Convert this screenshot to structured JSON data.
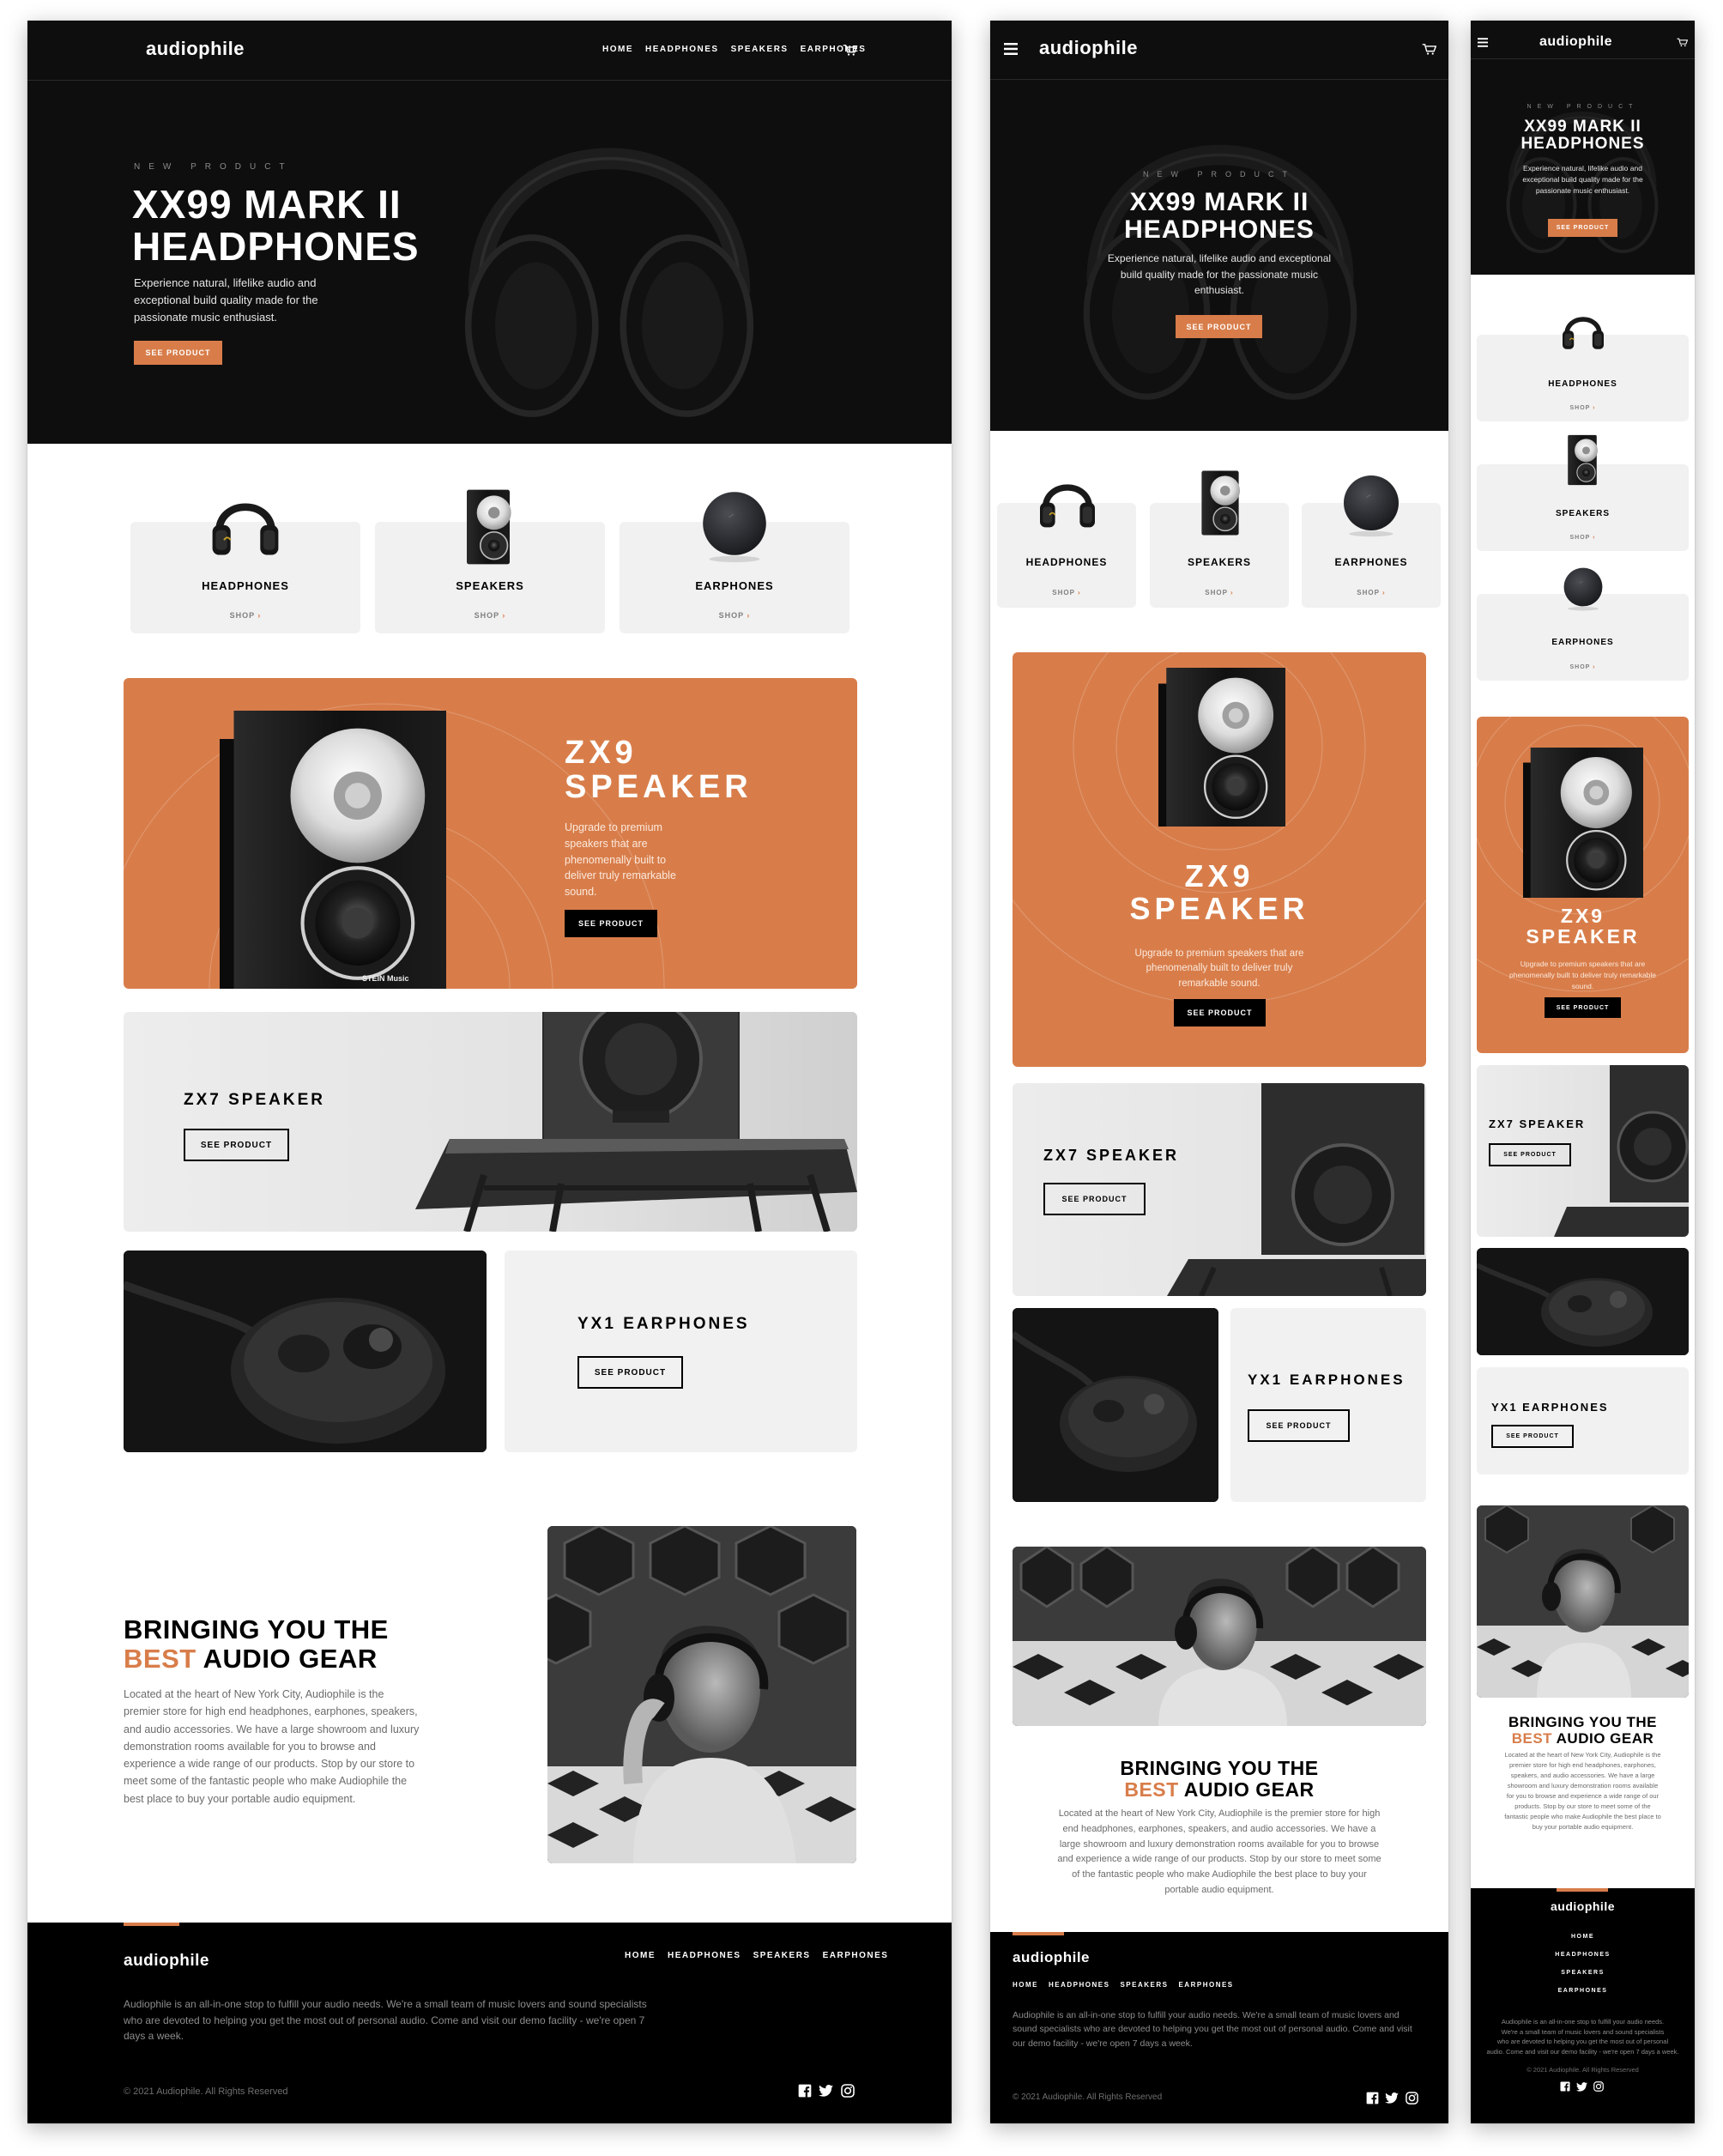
{
  "brand": {
    "name": "audiophile",
    "accent": "#d87d4a",
    "dark": "#000000",
    "card_bg": "#f1f1f1"
  },
  "nav": {
    "items": [
      "HOME",
      "HEADPHONES",
      "SPEAKERS",
      "EARPHONES"
    ],
    "cart_icon": "cart-icon",
    "menu_icon": "hamburger-icon"
  },
  "hero": {
    "overline": "NEW PRODUCT",
    "title_line1": "XX99 MARK II",
    "title_line2": "HEADPHONES",
    "description": "Experience natural, lifelike audio and exceptional build quality made for the passionate music enthusiast.",
    "desktop_desc_lines": [
      "Experience natural, lifelike audio and",
      "exceptional build quality made for the",
      "passionate music enthusiast."
    ],
    "tablet_desc_lines": [
      "Experience natural, lifelike audio and exceptional",
      "build quality made for the passionate music",
      "enthusiast."
    ],
    "mobile_desc_lines": [
      "Experience natural, lifelike audio and",
      "exceptional build quality made for the",
      "passionate music enthusiast."
    ],
    "cta": "SEE PRODUCT"
  },
  "categories": [
    {
      "name": "HEADPHONES",
      "shop": "SHOP"
    },
    {
      "name": "SPEAKERS",
      "shop": "SHOP"
    },
    {
      "name": "EARPHONES",
      "shop": "SHOP"
    }
  ],
  "zx9": {
    "title_line1": "ZX9",
    "title_line2": "SPEAKER",
    "description": "Upgrade to premium speakers that are phenomenally built to deliver truly remarkable sound.",
    "desktop_desc_lines": [
      "Upgrade to premium",
      "speakers that are",
      "phenomenally built to",
      "deliver truly remarkable",
      "sound."
    ],
    "tablet_desc_lines": [
      "Upgrade to premium speakers that are",
      "phenomenally built to deliver truly",
      "remarkable sound."
    ],
    "mobile_desc_lines": [
      "Upgrade to premium speakers that are",
      "phenomenally built to deliver truly remarkable",
      "sound."
    ],
    "brand_mark": "STEIN Music",
    "cta": "SEE PRODUCT"
  },
  "zx7": {
    "title": "ZX7 SPEAKER",
    "cta": "SEE PRODUCT"
  },
  "yx1": {
    "title": "YX1 EARPHONES",
    "cta": "SEE PRODUCT"
  },
  "about": {
    "title_line1": "BRINGING YOU THE",
    "title_accent": "BEST",
    "title_rest": "AUDIO GEAR",
    "description": "Located at the heart of New York City, Audiophile is the premier store for high end headphones, earphones, speakers, and audio accessories. We have a large showroom and luxury demonstration rooms available for you to browse and experience a wide range of our products. Stop by our store to meet some of the fantastic people who make Audiophile the best place to buy your portable audio equipment.",
    "desktop_desc_lines": [
      "Located at the heart of New York City, Audiophile is the",
      "premier store for high end headphones, earphones, speakers,",
      "and audio accessories. We have a large showroom and luxury",
      "demonstration rooms available for you to browse and",
      "experience a wide range of our products. Stop by our store to",
      "meet some of the fantastic people who make Audiophile the",
      "best place to buy your portable audio equipment."
    ],
    "tablet_desc_lines": [
      "Located at the heart of New York City, Audiophile is the premier store for high",
      "end headphones, earphones, speakers, and audio accessories. We have a",
      "large showroom and luxury demonstration rooms available for you to browse",
      "and experience a wide range of our products. Stop by our store to meet some",
      "of the fantastic people who make Audiophile the best place to buy your",
      "portable audio equipment."
    ],
    "mobile_desc_lines": [
      "Located at the heart of New York City, Audiophile is the",
      "premier store for high end headphones, earphones,",
      "speakers, and audio accessories. We have a large",
      "showroom and luxury demonstration rooms available",
      "for you to browse and experience a wide range of our",
      "products. Stop by our store to meet some of the",
      "fantastic people who make Audiophile the best place to",
      "buy your portable audio equipment."
    ]
  },
  "footer": {
    "description": "Audiophile is an all-in-one stop to fulfill your audio needs. We're a small team of music lovers and sound specialists who are devoted to helping you get the most out of personal audio. Come and visit our demo facility - we're open 7 days a week.",
    "desktop_desc_lines": [
      "Audiophile is an all-in-one stop to fulfill your audio needs. We're a small team of music lovers and sound specialists",
      "who are devoted to helping you get the most out of personal audio. Come and visit our demo facility - we're open 7",
      "days a week."
    ],
    "tablet_desc_lines": [
      "Audiophile is an all-in-one stop to fulfill your audio needs. We're a small team of music lovers and",
      "sound specialists who are devoted to helping you get the most out of personal audio. Come and visit",
      "our demo facility - we're open 7 days a week."
    ],
    "mobile_desc_lines": [
      "Audiophile is an all-in-one stop to fulfill your audio needs.",
      "We're a small team of music lovers and sound specialists",
      "who are devoted to helping you get the most out of personal",
      "audio. Come and visit our demo facility - we're open 7 days a week."
    ],
    "copyright": "© 2021 Audiophile. All Rights Reserved",
    "social": [
      "facebook-icon",
      "twitter-icon",
      "instagram-icon"
    ]
  }
}
